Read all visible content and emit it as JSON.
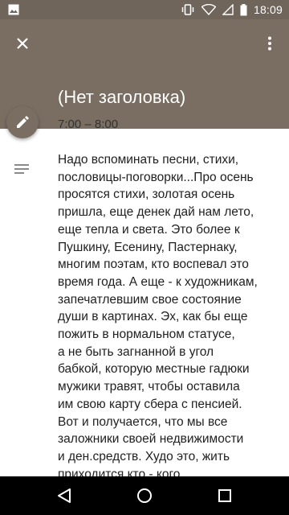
{
  "status_bar": {
    "time": "18:09",
    "icons": [
      "image-icon",
      "vibrate-icon",
      "wifi-icon",
      "signal-icon",
      "battery-icon"
    ]
  },
  "app_bar": {
    "title": "(Нет заголовка)",
    "actions": [
      "close-icon",
      "more-vert-icon"
    ]
  },
  "event": {
    "time_range": "7:00 – 8:00",
    "description": "Надо вспоминать песни, стихи,\nпословицы-поговорки...Про осень\nпросятся стихи, золотая осень\nпришла, еще денек дай нам лето,\nеще тепла и света. Это более к\nПушкину, Есенину, Пастернаку,\nмногим поэтам, кто воспевал это\nвремя года. А еще - к художникам,\nзапечатлевшим свое состояние\nдуши в картинах. Эх, как бы еще\nпожить в нормальном статусе,\nа не быть загнанной в угол\nбабкой, которую местные гадюки\nмужики травят, чтобы оставила\nим свою карту сбера с пенсией.\nВот и получается, что мы все\nзаложники своей недвижимости\nи ден.средств. Худо это, жить\nприходится кто - кого..."
  },
  "colors": {
    "header": "#7a6e63",
    "status_bar": "#6f655b",
    "text": "#212121",
    "icon_gray": "#8a8a8a"
  },
  "nav_bar": {
    "buttons": [
      "back-icon",
      "home-icon",
      "recents-icon"
    ]
  }
}
